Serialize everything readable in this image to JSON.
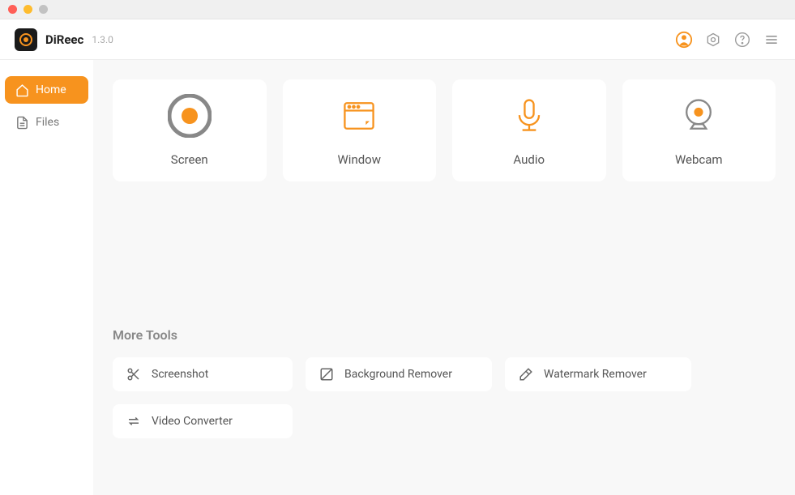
{
  "app": {
    "name": "DiReec",
    "version": "1.3.0"
  },
  "sidebar": {
    "items": [
      {
        "label": "Home",
        "active": true
      },
      {
        "label": "Files",
        "active": false
      }
    ]
  },
  "record_modes": [
    {
      "label": "Screen"
    },
    {
      "label": "Window"
    },
    {
      "label": "Audio"
    },
    {
      "label": "Webcam"
    }
  ],
  "more_tools": {
    "title": "More Tools",
    "items": [
      {
        "label": "Screenshot"
      },
      {
        "label": "Background Remover"
      },
      {
        "label": "Watermark Remover"
      },
      {
        "label": "Video Converter"
      }
    ]
  }
}
